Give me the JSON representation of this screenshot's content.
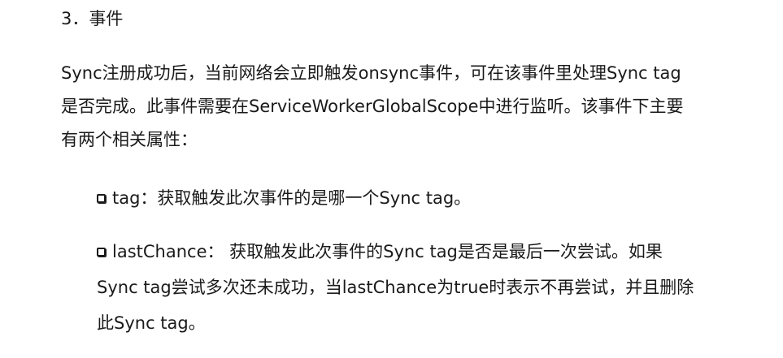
{
  "heading": "3．事件",
  "paragraph": {
    "lines": [
      "Sync注册成功后，当前网络会立即触发onsync事件，可在该事件里处理Sync tag",
      "是否完成。此事件需要在ServiceWorkerGlobalScope中进行监听。该事件下主要",
      "有两个相关属性："
    ]
  },
  "bullets": [
    {
      "icon": "checkbox-icon",
      "lines": [
        "tag：获取触发此次事件的是哪一个Sync tag。"
      ]
    },
    {
      "icon": "checkbox-icon",
      "lines": [
        "lastChance： 获取触发此次事件的Sync tag是否是最后一次尝试。如果",
        "Sync tag尝试多次还未成功，当lastChance为true时表示不再尝试，并且删除",
        "此Sync tag。"
      ]
    }
  ]
}
